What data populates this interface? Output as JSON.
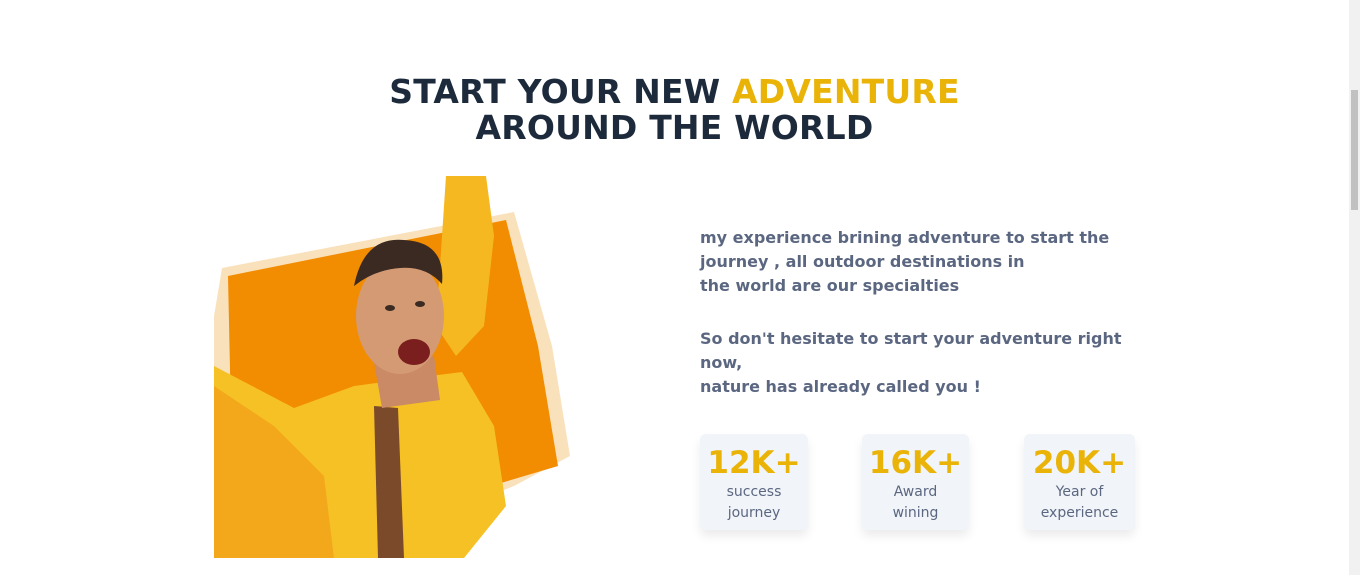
{
  "heading": {
    "line1_prefix": "START YOUR NEW ",
    "line1_accent": "ADVENTURE",
    "line2": "AROUND THE WORLD"
  },
  "intro": {
    "p1_lines": [
      "my experience brining adventure to start the",
      "journey , all outdoor destinations in",
      "the world are our specialties"
    ],
    "p2_lines": [
      "So don't hesitate to start your adventure right now,",
      "nature has already called you !"
    ]
  },
  "stats": [
    {
      "value": "12K+",
      "label_lines": [
        "success",
        "journey"
      ]
    },
    {
      "value": "16K+",
      "label_lines": [
        "Award",
        "wining"
      ]
    },
    {
      "value": "20K+",
      "label_lines": [
        "Year of",
        "experience"
      ]
    }
  ],
  "colors": {
    "heading": "#1c2a3b",
    "accent": "#eab308",
    "body_text": "#5b6781",
    "card_bg": "#f1f4f8",
    "orange": "#f28c00"
  }
}
